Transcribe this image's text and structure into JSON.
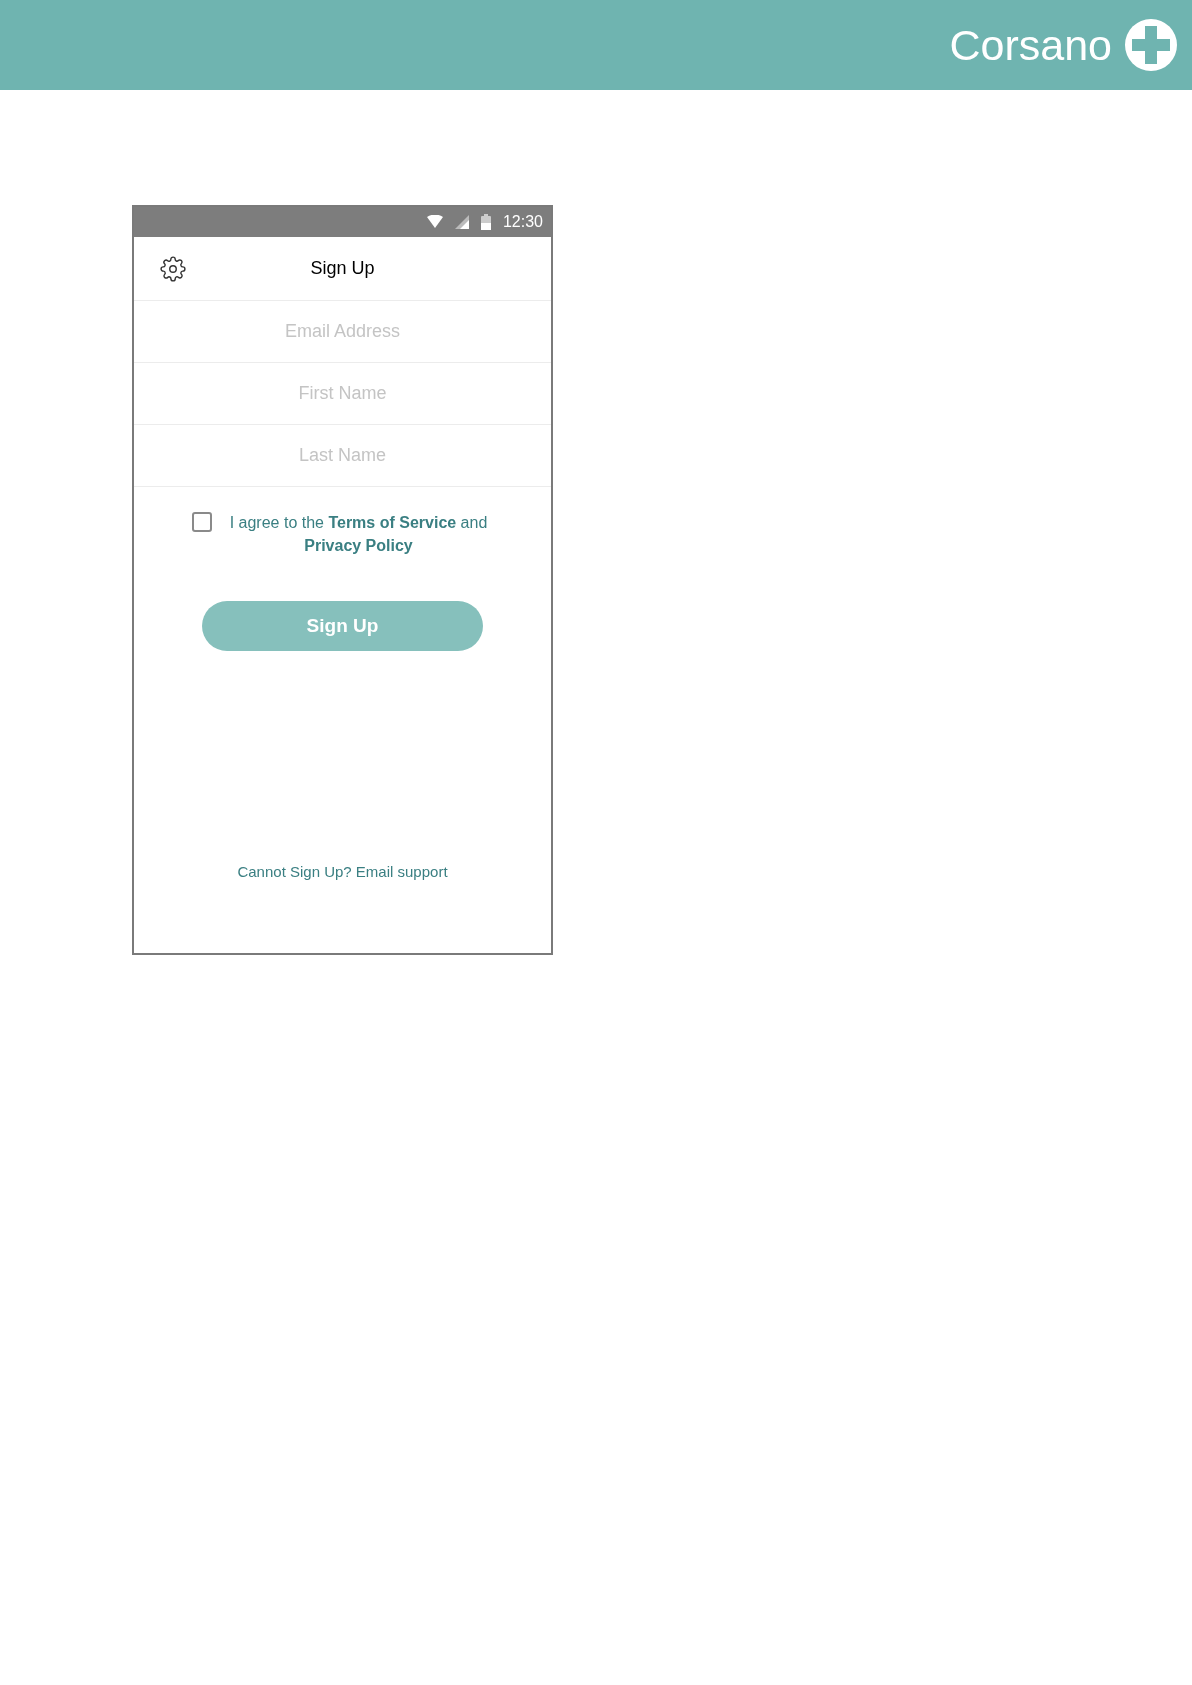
{
  "header": {
    "brand": "Corsano"
  },
  "phone": {
    "status_bar": {
      "time": "12:30"
    },
    "title": "Sign Up",
    "fields": [
      {
        "placeholder": "Email Address"
      },
      {
        "placeholder": "First Name"
      },
      {
        "placeholder": "Last Name"
      }
    ],
    "agreement": {
      "checked": false,
      "text": "I agree to the **Terms of Service** and **Privacy Policy**"
    },
    "submit": {
      "label": "Sign Up"
    },
    "support_link": "Cannot Sign Up? Email support"
  }
}
